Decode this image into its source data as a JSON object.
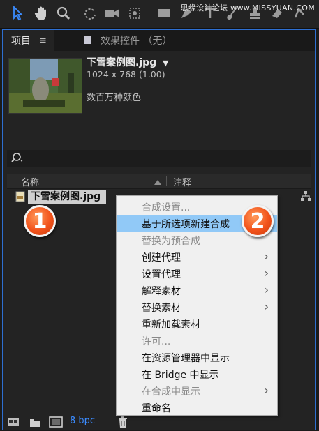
{
  "watermark": "思缘设计论坛 www.MISSYUAN.COM",
  "tabs": {
    "project": "项目",
    "project_menu": "≡",
    "effects": "效果控件 （无）"
  },
  "item_info": {
    "name": "下雪案例图.jpg",
    "dimensions": "1024 x 768 (1.00)",
    "colors": "数百万种颜色"
  },
  "columns": {
    "name": "名称",
    "comment": "注释"
  },
  "file_row": {
    "name": "下雪案例图.jpg"
  },
  "bottom": {
    "bpc": "8 bpc"
  },
  "context_menu": [
    {
      "label": "合成设置...",
      "disabled": true,
      "submenu": false,
      "highlight": false
    },
    {
      "label": "基于所选项新建合成",
      "disabled": false,
      "submenu": false,
      "highlight": true
    },
    {
      "label": "替换为预合成",
      "disabled": true,
      "submenu": false,
      "highlight": false
    },
    {
      "label": "创建代理",
      "disabled": false,
      "submenu": true,
      "highlight": false
    },
    {
      "label": "设置代理",
      "disabled": false,
      "submenu": true,
      "highlight": false
    },
    {
      "label": "解释素材",
      "disabled": false,
      "submenu": true,
      "highlight": false
    },
    {
      "label": "替换素材",
      "disabled": false,
      "submenu": true,
      "highlight": false
    },
    {
      "label": "重新加载素材",
      "disabled": false,
      "submenu": false,
      "highlight": false
    },
    {
      "label": "许可...",
      "disabled": true,
      "submenu": false,
      "highlight": false
    },
    {
      "label": "在资源管理器中显示",
      "disabled": false,
      "submenu": false,
      "highlight": false
    },
    {
      "label": "在 Bridge 中显示",
      "disabled": false,
      "submenu": false,
      "highlight": false
    },
    {
      "label": "在合成中显示",
      "disabled": true,
      "submenu": true,
      "highlight": false
    },
    {
      "label": "重命名",
      "disabled": false,
      "submenu": false,
      "highlight": false
    }
  ],
  "badges": {
    "first": "1",
    "second": "2"
  },
  "colors": {
    "accent_blue": "#2e6fd1",
    "highlight": "#91c9f7",
    "badge_orange": "#f2531b"
  }
}
